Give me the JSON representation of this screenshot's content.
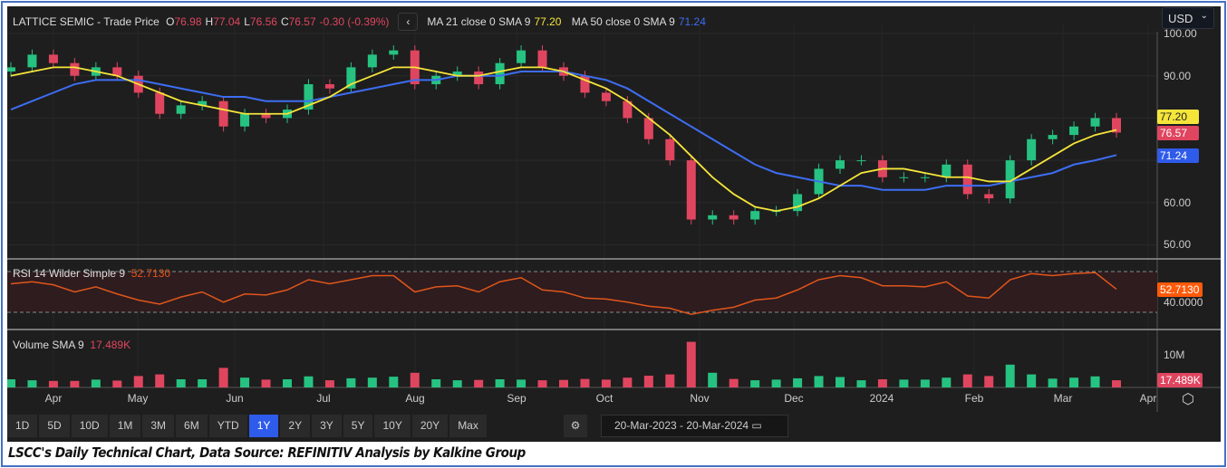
{
  "legend": {
    "name": "LATTICE SEMIC - Trade Price",
    "o_label": "O",
    "o": "76.98",
    "h_label": "H",
    "h": "77.04",
    "l_label": "L",
    "l": "76.56",
    "c_label": "C",
    "c": "76.57",
    "change": "-0.30 (-0.39%)",
    "ma21_label": "MA 21 close 0 SMA 9",
    "ma21": "77.20",
    "ma50_label": "MA 50 close 0 SMA 9",
    "ma50": "71.24"
  },
  "currency": "USD",
  "price_axis": [
    "100.00",
    "90.00",
    "60.00",
    "50.00"
  ],
  "flags": {
    "ma21": "77.20",
    "close": "76.57",
    "ma50": "71.24",
    "rsi": "52.7130",
    "volume": "17.489K"
  },
  "rsi": {
    "label": "RSI 14 Wilder Simple 9",
    "value": "52.7130",
    "axis": "40.0000"
  },
  "volume": {
    "label": "Volume SMA 9",
    "value": "17.489K",
    "axis": "10M"
  },
  "months": [
    "Apr",
    "May",
    "Jun",
    "Jul",
    "Aug",
    "Sep",
    "Oct",
    "Nov",
    "Dec",
    "2024",
    "Feb",
    "Mar",
    "Apr"
  ],
  "ranges": [
    "1D",
    "5D",
    "10D",
    "1M",
    "3M",
    "6M",
    "YTD",
    "1Y",
    "2Y",
    "3Y",
    "5Y",
    "10Y",
    "20Y",
    "Max"
  ],
  "active_range": "1Y",
  "date_from": "20-Mar-2023",
  "date_to": "20-Mar-2024",
  "caption": "LSCC's Daily Technical Chart, Data Source: REFINITIV  Analysis by Kalkine Group",
  "colors": {
    "up": "#26c281",
    "down": "#e0455f",
    "ma21": "#f5e53a",
    "ma50": "#3d6df2",
    "rsi": "#e0561a",
    "active": "#2f5bea"
  },
  "chart_data": {
    "type": "candlestick",
    "x": [
      "2023-03-20",
      "2023-03-27",
      "2023-04-03",
      "2023-04-10",
      "2023-04-17",
      "2023-04-24",
      "2023-05-01",
      "2023-05-08",
      "2023-05-15",
      "2023-05-22",
      "2023-05-29",
      "2023-06-05",
      "2023-06-12",
      "2023-06-19",
      "2023-06-26",
      "2023-07-03",
      "2023-07-10",
      "2023-07-17",
      "2023-07-24",
      "2023-07-31",
      "2023-08-07",
      "2023-08-14",
      "2023-08-21",
      "2023-08-28",
      "2023-09-04",
      "2023-09-11",
      "2023-09-18",
      "2023-09-25",
      "2023-10-02",
      "2023-10-09",
      "2023-10-16",
      "2023-10-23",
      "2023-10-30",
      "2023-11-06",
      "2023-11-13",
      "2023-11-20",
      "2023-11-27",
      "2023-12-04",
      "2023-12-11",
      "2023-12-18",
      "2023-12-25",
      "2024-01-01",
      "2024-01-08",
      "2024-01-15",
      "2024-01-22",
      "2024-01-29",
      "2024-02-05",
      "2024-02-12",
      "2024-02-19",
      "2024-02-26",
      "2024-03-04",
      "2024-03-11",
      "2024-03-18"
    ],
    "close": [
      92,
      95,
      93,
      90,
      92,
      90,
      86,
      81,
      83,
      84,
      78,
      81,
      80,
      82,
      88,
      87,
      92,
      95,
      96,
      88,
      90,
      91,
      88,
      93,
      96,
      92,
      90,
      86,
      84,
      80,
      75,
      70,
      56,
      57,
      56,
      58,
      58,
      62,
      68,
      70,
      70,
      66,
      66,
      66,
      69,
      62,
      61,
      70,
      75,
      76,
      78,
      80,
      76.57
    ],
    "ma21": [
      90,
      91,
      92,
      92,
      91,
      90,
      88,
      86,
      84,
      83,
      82,
      81,
      81,
      81,
      83,
      85,
      88,
      90,
      92,
      92,
      91,
      90,
      90,
      91,
      92,
      92,
      91,
      89,
      87,
      84,
      80,
      76,
      71,
      66,
      62,
      59,
      58,
      59,
      61,
      64,
      67,
      68,
      68,
      67,
      66,
      66,
      65,
      65,
      68,
      71,
      74,
      76,
      77.2
    ],
    "ma50": [
      82,
      84,
      86,
      88,
      89,
      89,
      89,
      88,
      87,
      86,
      85,
      85,
      84,
      84,
      84,
      85,
      86,
      87,
      88,
      89,
      89,
      90,
      90,
      90,
      91,
      91,
      91,
      90,
      89,
      87,
      84,
      81,
      78,
      75,
      72,
      69,
      67,
      66,
      65,
      64,
      64,
      63,
      63,
      63,
      64,
      64,
      64,
      65,
      66,
      67,
      69,
      70,
      71.24
    ],
    "rsi": [
      58,
      60,
      57,
      50,
      55,
      48,
      42,
      38,
      45,
      50,
      40,
      48,
      47,
      52,
      62,
      58,
      62,
      66,
      66,
      50,
      55,
      56,
      50,
      60,
      64,
      52,
      50,
      44,
      43,
      40,
      36,
      34,
      28,
      32,
      35,
      42,
      44,
      52,
      62,
      66,
      64,
      56,
      56,
      55,
      60,
      46,
      44,
      62,
      68,
      66,
      68,
      69,
      52.713
    ],
    "volume_m": [
      2.5,
      2.2,
      2,
      2,
      2.4,
      2.1,
      3.5,
      4,
      2.5,
      2.5,
      6,
      3,
      2.4,
      2.5,
      3.4,
      2.2,
      2.8,
      3,
      3.3,
      4.5,
      2.5,
      2.2,
      2.3,
      2.5,
      2.4,
      2.2,
      2.3,
      2.6,
      2.4,
      3,
      3.6,
      4,
      14,
      4.5,
      2.6,
      2.2,
      2.4,
      2.8,
      3.5,
      3.2,
      2.2,
      2.5,
      2.4,
      2.4,
      3,
      4,
      3.5,
      7,
      4,
      2.7,
      3,
      3.4,
      2.2
    ],
    "ylim": [
      50,
      100
    ],
    "rsi_levels": [
      30,
      70
    ]
  }
}
